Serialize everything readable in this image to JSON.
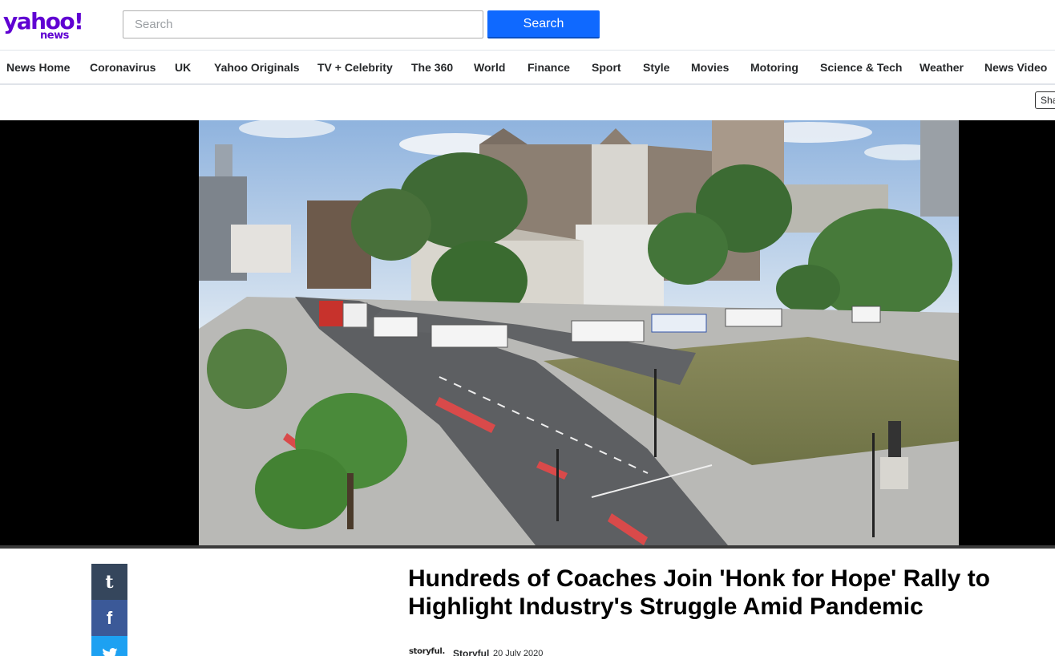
{
  "brand": {
    "logo_word": "yahoo!",
    "logo_sub": "news",
    "color": "#6001d2"
  },
  "search": {
    "placeholder": "Search",
    "button_label": "Search",
    "accent": "#0f69ff"
  },
  "nav": {
    "items": [
      "News Home",
      "Coronavirus",
      "UK",
      "Yahoo Originals",
      "TV + Celebrity",
      "The 360",
      "World",
      "Finance",
      "Sport",
      "Style",
      "Movies",
      "Motoring",
      "Science & Tech",
      "Weather",
      "News Video"
    ]
  },
  "toolbar": {
    "share_label": "Share"
  },
  "video": {
    "scene": "Parliament Square, London — coaches on the road"
  },
  "social": {
    "tumblr_glyph": "t",
    "facebook_glyph": "f",
    "icons": [
      "tumblr-icon",
      "facebook-icon",
      "twitter-icon"
    ],
    "colors": {
      "tumblr": "#35465c",
      "facebook": "#3b5998",
      "twitter": "#1da1f2"
    }
  },
  "article": {
    "title": "Hundreds of Coaches Join 'Honk for Hope' Rally to Highlight Industry's Struggle Amid Pandemic",
    "provider_logo": "storyful.",
    "provider": "Storyful",
    "date": "20 July 2020"
  }
}
